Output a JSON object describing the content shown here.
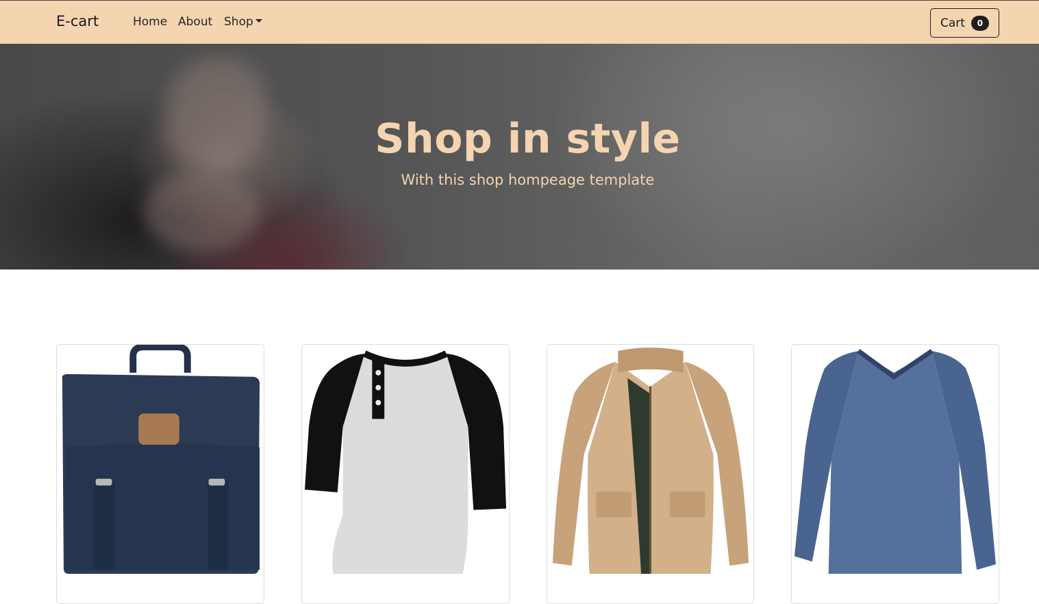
{
  "navbar": {
    "brand": "E-cart",
    "links": [
      {
        "label": "Home"
      },
      {
        "label": "About"
      },
      {
        "label": "Shop"
      }
    ],
    "cart": {
      "label": "Cart",
      "count": "0"
    },
    "bg_color": "#f5d4b0"
  },
  "hero": {
    "title": "Shop in style",
    "subtitle": "With this shop hompeage template",
    "text_color": "#f5d4b0"
  },
  "products": [
    {
      "image": "navy-backpack"
    },
    {
      "image": "raglan-henley-shirt"
    },
    {
      "image": "khaki-jacket"
    },
    {
      "image": "blue-long-sleeve-shirt"
    }
  ]
}
